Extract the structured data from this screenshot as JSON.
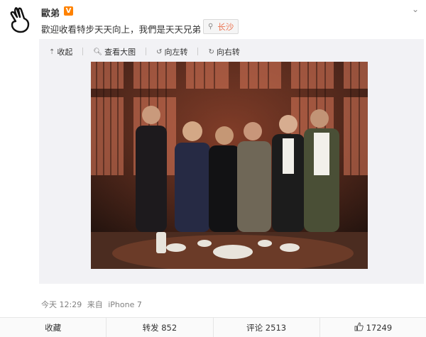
{
  "user": {
    "name": "歐弟",
    "verified_badge": "V"
  },
  "post": {
    "text": "歡迎收看特步天天向上，我們是天天兄弟",
    "location": "长沙"
  },
  "media_toolbar": {
    "collapse": "收起",
    "view_large": "查看大图",
    "rotate_left": "向左转",
    "rotate_right": "向右转"
  },
  "meta": {
    "time": "今天 12:29",
    "from_label": "来自",
    "device": "iPhone 7"
  },
  "actions": {
    "favorite": "收藏",
    "repost": "转发 852",
    "comment": "评论 2513",
    "like": "17249"
  },
  "colors": {
    "accent": "#eb7350",
    "verified": "#ff8200"
  }
}
